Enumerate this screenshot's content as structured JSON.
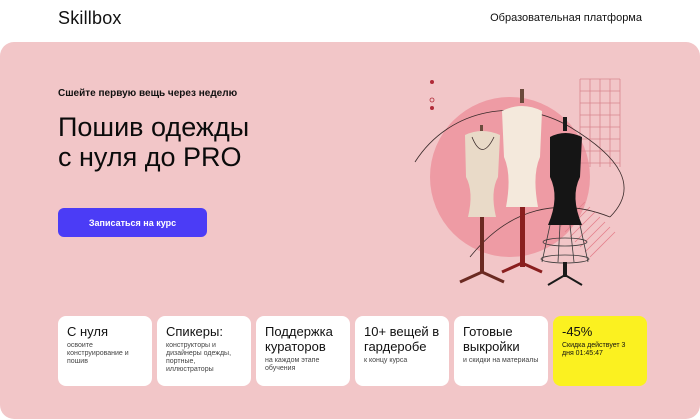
{
  "header": {
    "logo": "Skillbox",
    "tagline": "Образовательная платформа"
  },
  "hero": {
    "subtitle": "Сшейте первую вещь через неделю",
    "title_line1": "Пошив одежды",
    "title_line2": "с нуля до PRO",
    "cta_label": "Записаться на курс",
    "art_icon": "mannequins-illustration"
  },
  "cards": [
    {
      "title": "С нуля",
      "text": "освоите конструирование и пошив"
    },
    {
      "title": "Спикеры:",
      "text": "конструкторы и дизайнеры одежды, портные, иллюстраторы"
    },
    {
      "title": "Поддержка кураторов",
      "text": "на каждом этапе обучения"
    },
    {
      "title": "10+ вещей в гардеробе",
      "text": "к концу курса"
    },
    {
      "title": "Готовые выкройки",
      "text": "и скидки на материалы"
    },
    {
      "title": "-45%",
      "text": "Скидка действует 3 дня 01:45:47"
    }
  ],
  "colors": {
    "hero_bg": "#f2c6c8",
    "accent": "#4b3cf6",
    "highlight": "#fbf120",
    "circle": "#ee9ba4"
  }
}
